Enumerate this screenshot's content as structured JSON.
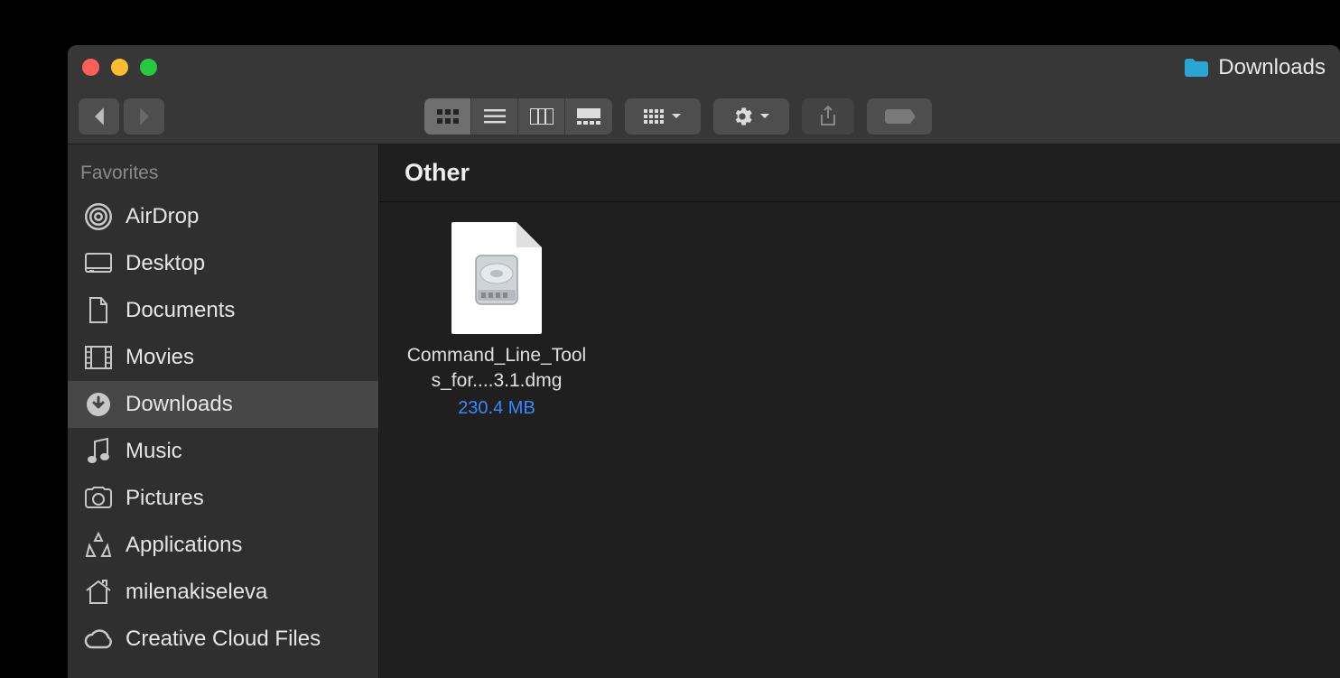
{
  "window": {
    "folder_name": "Downloads"
  },
  "sidebar": {
    "heading": "Favorites",
    "items": [
      {
        "label": "AirDrop",
        "icon": "airdrop-icon",
        "selected": false
      },
      {
        "label": "Desktop",
        "icon": "desktop-icon",
        "selected": false
      },
      {
        "label": "Documents",
        "icon": "documents-icon",
        "selected": false
      },
      {
        "label": "Movies",
        "icon": "movies-icon",
        "selected": false
      },
      {
        "label": "Downloads",
        "icon": "downloads-icon",
        "selected": true
      },
      {
        "label": "Music",
        "icon": "music-icon",
        "selected": false
      },
      {
        "label": "Pictures",
        "icon": "pictures-icon",
        "selected": false
      },
      {
        "label": "Applications",
        "icon": "applications-icon",
        "selected": false
      },
      {
        "label": "milenakiseleva",
        "icon": "home-icon",
        "selected": false
      },
      {
        "label": "Creative Cloud Files",
        "icon": "creative-cloud-icon",
        "selected": false
      }
    ]
  },
  "content": {
    "section_title": "Other",
    "files": [
      {
        "name": "Command_Line_Tools_for....3.1.dmg",
        "size": "230.4 MB"
      }
    ]
  }
}
